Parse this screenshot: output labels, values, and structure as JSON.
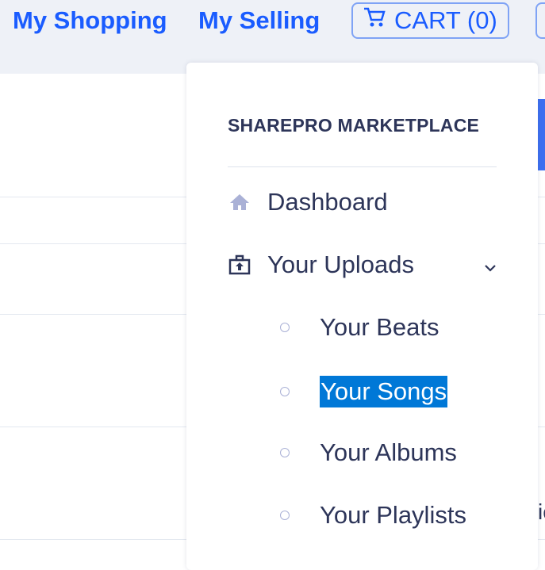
{
  "header": {
    "my_shopping": "My Shopping",
    "my_selling": "My Selling",
    "cart_label": "CART (0)",
    "cart_icon": "shopping-cart-icon",
    "accent": "#1a5cff"
  },
  "background": {
    "edge_text": "ic"
  },
  "menu": {
    "brand": "SHAREPRO MARKETPLACE",
    "items": [
      {
        "label": "Dashboard",
        "icon": "home-icon"
      },
      {
        "label": "Your Uploads",
        "icon": "upload-briefcase-icon",
        "expanded": true
      }
    ],
    "subitems": [
      {
        "label": "Your Beats"
      },
      {
        "label": "Your Songs",
        "selected": true
      },
      {
        "label": "Your Albums"
      },
      {
        "label": "Your Playlists"
      }
    ]
  }
}
